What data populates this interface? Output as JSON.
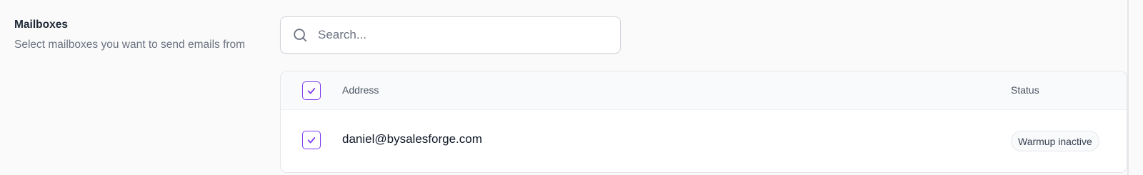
{
  "section": {
    "title": "Mailboxes",
    "description": "Select mailboxes you want to send emails from"
  },
  "search": {
    "placeholder": "Search...",
    "value": ""
  },
  "table": {
    "columns": {
      "address": "Address",
      "status": "Status"
    },
    "select_all_checked": true,
    "rows": [
      {
        "address": "daniel@bysalesforge.com",
        "status": "Warmup inactive",
        "checked": true
      }
    ]
  },
  "colors": {
    "accent": "#7c3aed",
    "background": "#fafafa"
  },
  "icons": {
    "search": "search-icon",
    "check": "check-icon"
  }
}
